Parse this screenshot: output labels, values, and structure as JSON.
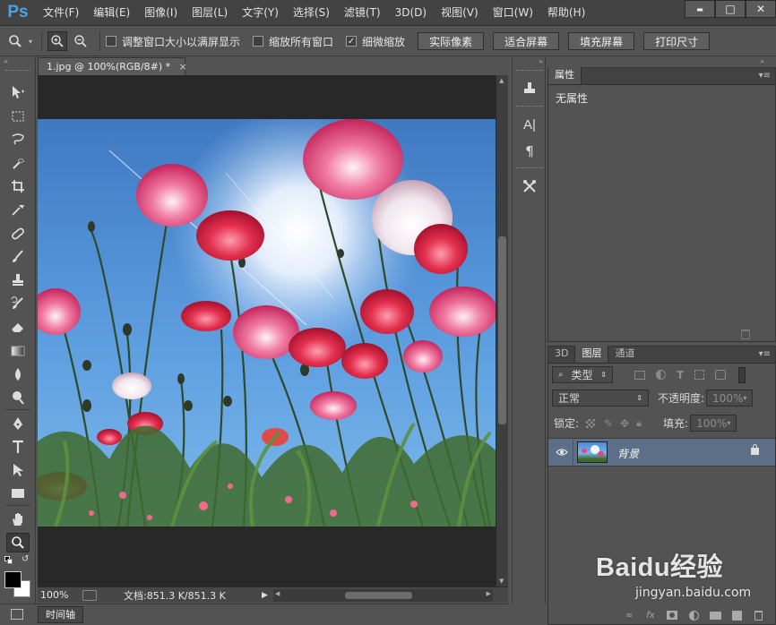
{
  "app": {
    "logo": "Ps",
    "menu": [
      "文件(F)",
      "编辑(E)",
      "图像(I)",
      "图层(L)",
      "文字(Y)",
      "选择(S)",
      "滤镜(T)",
      "3D(D)",
      "视图(V)",
      "窗口(W)",
      "帮助(H)"
    ],
    "window_controls": {
      "minimize": "▬",
      "maximize": "□",
      "close": "✕"
    }
  },
  "options": {
    "checkboxes": [
      {
        "label": "调整窗口大小以满屏显示",
        "checked": false
      },
      {
        "label": "缩放所有窗口",
        "checked": false
      },
      {
        "label": "细微缩放",
        "checked": true
      }
    ],
    "buttons": [
      "实际像素",
      "适合屏幕",
      "填充屏幕",
      "打印尺寸"
    ]
  },
  "tools": [
    "move-tool",
    "marquee-tool",
    "lasso-tool",
    "quick-select-tool",
    "crop-tool",
    "eyedropper-tool",
    "healing-brush-tool",
    "brush-tool",
    "clone-stamp-tool",
    "history-brush-tool",
    "eraser-tool",
    "gradient-tool",
    "blur-tool",
    "dodge-tool",
    "pen-tool",
    "type-tool",
    "path-select-tool",
    "rectangle-tool",
    "hand-tool",
    "zoom-tool"
  ],
  "document": {
    "tab_title": "1.jpg @ 100%(RGB/8#) *",
    "tab_close": "×",
    "status_zoom": "100%",
    "status_doc": "文档:851.3 K/851.3 K"
  },
  "timeline": {
    "label": "时间轴"
  },
  "properties": {
    "tab": "属性",
    "content": "无属性"
  },
  "layers_panel": {
    "tabs": [
      "3D",
      "图层",
      "通道"
    ],
    "filter_label": "类型",
    "blend_mode": "正常",
    "opacity_label": "不透明度:",
    "opacity_value": "100%",
    "lock_label": "锁定:",
    "fill_label": "填充:",
    "fill_value": "100%",
    "layers": [
      {
        "name": "背景",
        "visible": true,
        "locked": true
      }
    ],
    "footer_fx": "fx"
  },
  "watermark": {
    "brand": "Baidu经验",
    "url": "jingyan.baidu.com"
  }
}
